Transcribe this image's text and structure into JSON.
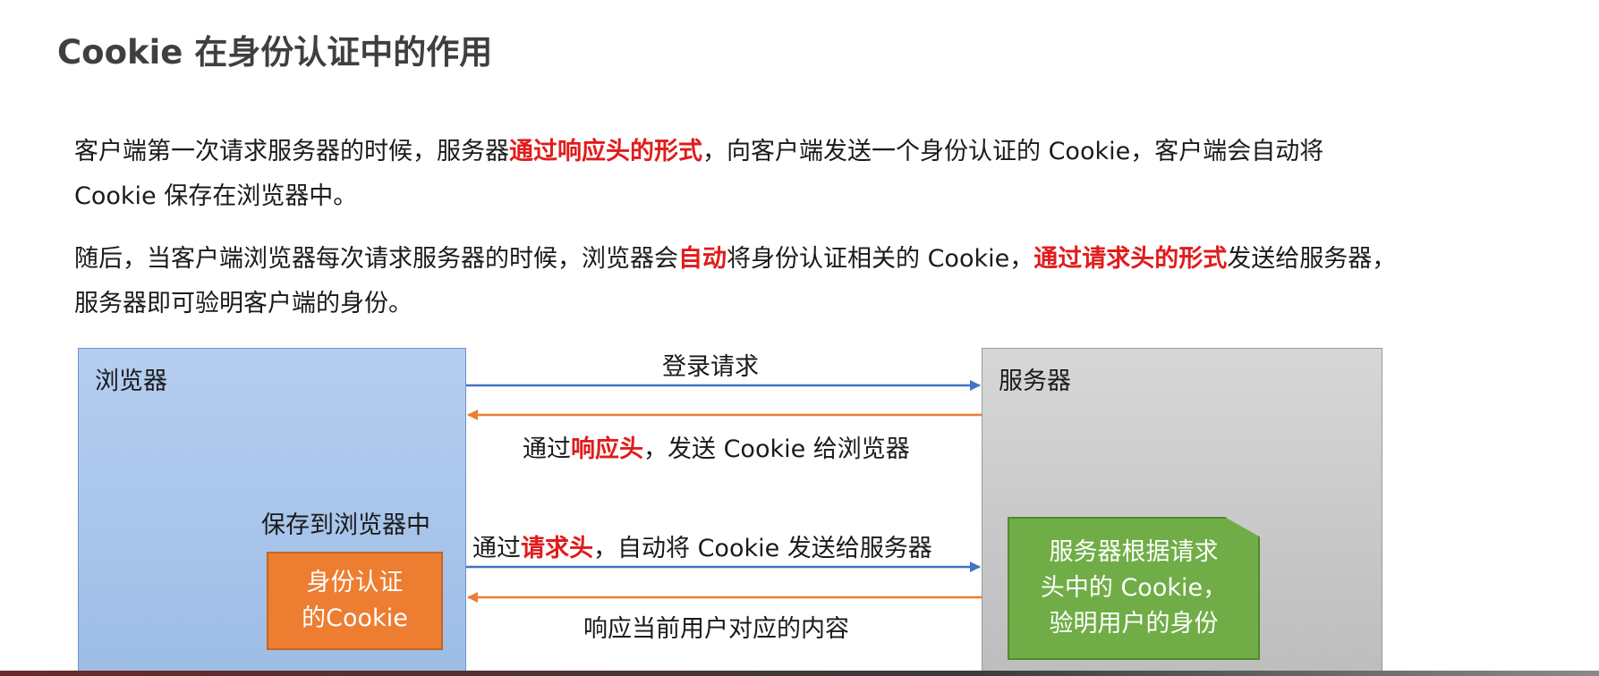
{
  "title": "Cookie 在身份认证中的作用",
  "paragraph1": {
    "part1": "客户端第一次请求服务器的时候，服务器",
    "highlight1": "通过响应头的形式",
    "part2": "，向客户端发送一个身份认证的 Cookie，客户端会自动将 Cookie 保存在浏览器中。"
  },
  "paragraph2": {
    "part1": "随后，当客户端浏览器每次请求服务器的时候，浏览器会",
    "highlight1": "自动",
    "part2": "将身份认证相关的 Cookie，",
    "highlight2": "通过请求头的形式",
    "part3": "发送给服务器，服务器即可验明客户端的身份。"
  },
  "diagram": {
    "browser_label": "浏览器",
    "server_label": "服务器",
    "login_request": "登录请求",
    "response_cookie": {
      "prefix": "通过",
      "highlight": "响应头",
      "suffix": "，发送 Cookie 给浏览器"
    },
    "save_label": "保存到浏览器中",
    "cookie_box": {
      "line1": "身份认证",
      "line2": "的Cookie"
    },
    "request_cookie": {
      "prefix": "通过",
      "highlight": "请求头",
      "suffix": "，自动将 Cookie 发送给服务器"
    },
    "response_content": "响应当前用户对应的内容",
    "server_note": {
      "line1": "服务器根据请求",
      "line2": "头中的 Cookie，",
      "line3": "验明用户的身份"
    }
  },
  "colors": {
    "highlight": "#e11b1b",
    "request_arrow": "#4472c4",
    "response_arrow": "#ed7d31",
    "browser_panel": "#a9c6ec",
    "server_panel": "#c8c8c8",
    "cookie_box": "#ed7d31",
    "server_note": "#70ad47"
  }
}
